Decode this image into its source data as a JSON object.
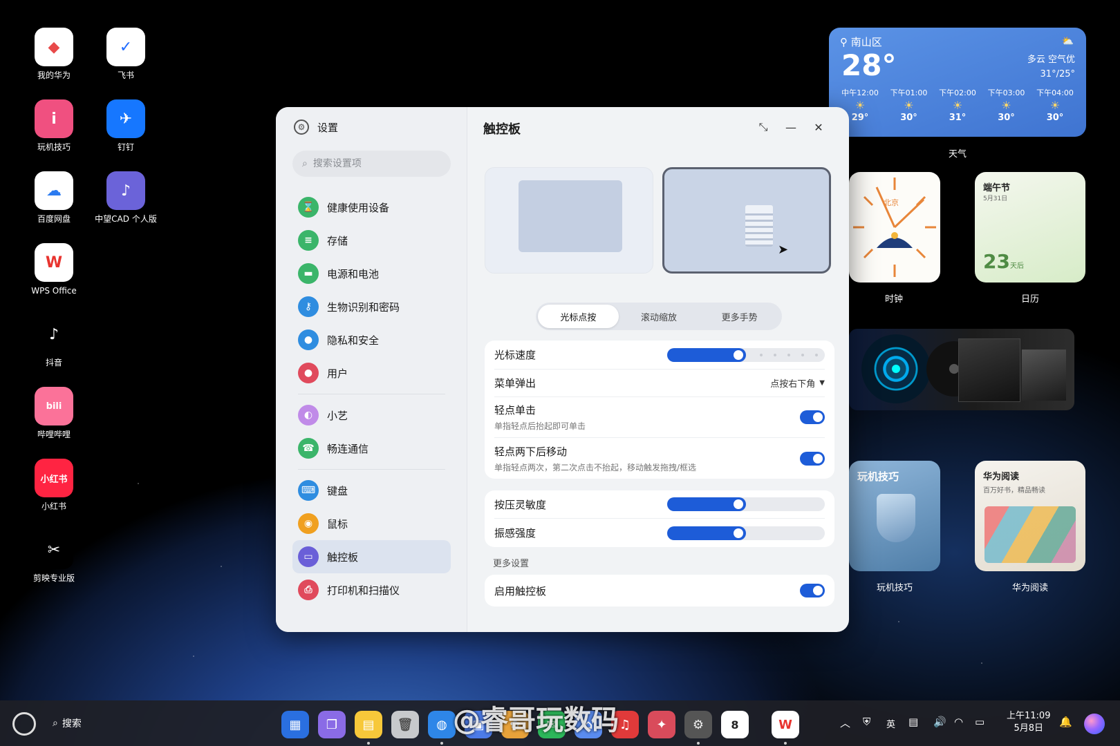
{
  "desktop": {
    "icons": [
      {
        "label": "我的华为",
        "glyph": "◆",
        "color": "#e84a4a",
        "bg": "#ffffff"
      },
      {
        "label": "飞书",
        "glyph": "✓",
        "color": "#1f6bff",
        "bg": "#ffffff"
      },
      {
        "label": "玩机技巧",
        "glyph": "i",
        "color": "#ffffff",
        "bg": "#f05080"
      },
      {
        "label": "钉钉",
        "glyph": "✈",
        "color": "#ffffff",
        "bg": "#1677ff"
      },
      {
        "label": "百度网盘",
        "glyph": "☁",
        "color": "#2b7bf0",
        "bg": "#ffffff"
      },
      {
        "label": "中望CAD 个人版",
        "glyph": "♪",
        "color": "#ffffff",
        "bg": "#6b63d9"
      },
      {
        "label": "WPS Office",
        "glyph": "W",
        "color": "#e8342f",
        "bg": "#ffffff"
      },
      {
        "label": "抖音",
        "glyph": "♪",
        "color": "#ffffff",
        "bg": "#000000"
      },
      {
        "label": "哔哩哔哩",
        "glyph": "bili",
        "color": "#ffffff",
        "bg": "#fb7299"
      },
      {
        "label": "小红书",
        "glyph": "小红书",
        "color": "#ffffff",
        "bg": "#ff2442"
      },
      {
        "label": "剪映专业版",
        "glyph": "✂",
        "color": "#ffffff",
        "bg": "#000000"
      }
    ]
  },
  "widgets": {
    "weather": {
      "location": "南山区",
      "temp": "28°",
      "condition": "多云  空气优",
      "range": "31°/25°",
      "hours": [
        {
          "time": "中午12:00",
          "temp": "29°"
        },
        {
          "time": "下午01:00",
          "temp": "30°"
        },
        {
          "time": "下午02:00",
          "temp": "31°"
        },
        {
          "time": "下午03:00",
          "temp": "30°"
        },
        {
          "time": "下午04:00",
          "temp": "30°"
        }
      ],
      "label": "天气"
    },
    "clock": {
      "city": "北京",
      "label": "时钟"
    },
    "calendar": {
      "title": "端午节",
      "date_sub": "5月31日",
      "days": "23",
      "days_unit": "天后",
      "label": "日历"
    },
    "tips": {
      "title": "玩机技巧",
      "label": "玩机技巧"
    },
    "reading": {
      "title": "华为阅读",
      "subtitle": "百万好书，精品畅读",
      "label": "华为阅读"
    }
  },
  "settings": {
    "app_title": "设置",
    "search_placeholder": "搜索设置项",
    "nav_items": [
      {
        "label": "健康使用设备",
        "glyph": "⌛",
        "color": "#3bb56a"
      },
      {
        "label": "存储",
        "glyph": "≡",
        "color": "#3bb56a"
      },
      {
        "label": "电源和电池",
        "glyph": "▬",
        "color": "#3bb56a"
      },
      {
        "label": "生物识别和密码",
        "glyph": "⚷",
        "color": "#2f8de0"
      },
      {
        "label": "隐私和安全",
        "glyph": "●",
        "color": "#2f8de0"
      },
      {
        "label": "用户",
        "glyph": "●",
        "color": "#e04a5c"
      }
    ],
    "nav_items_2": [
      {
        "label": "小艺",
        "glyph": "◐",
        "color": "#c08be8"
      },
      {
        "label": "畅连通信",
        "glyph": "☎",
        "color": "#3bb56a"
      }
    ],
    "nav_items_3": [
      {
        "label": "键盘",
        "glyph": "⌨",
        "color": "#2f8de0"
      },
      {
        "label": "鼠标",
        "glyph": "◉",
        "color": "#f0a020"
      },
      {
        "label": "触控板",
        "glyph": "▭",
        "color": "#6a5fd8"
      },
      {
        "label": "打印机和扫描仪",
        "glyph": "⎙",
        "color": "#e04a5c"
      }
    ],
    "page_title": "触控板",
    "tabs": [
      "光标点按",
      "滚动缩放",
      "更多手势"
    ],
    "cursor_speed": {
      "label": "光标速度",
      "value": 0.5
    },
    "menu_popup": {
      "label": "菜单弹出",
      "value": "点按右下角"
    },
    "tap_click": {
      "label": "轻点单击",
      "desc": "单指轻点后抬起即可单击",
      "on": true
    },
    "double_tap_move": {
      "label": "轻点两下后移动",
      "desc": "单指轻点两次，第二次点击不抬起，移动触发拖拽/框选",
      "on": true
    },
    "press_sensitivity": {
      "label": "按压灵敏度",
      "value": 0.5
    },
    "vibration": {
      "label": "振感强度",
      "value": 0.5
    },
    "more_settings": "更多设置",
    "enable_touchpad": {
      "label": "启用触控板",
      "on": true
    }
  },
  "taskbar": {
    "search_label": "搜索",
    "time": "上午11:09",
    "date": "5月8日",
    "input_method": "英",
    "calendar_day": "8",
    "watermark": "@睿哥玩数码"
  }
}
